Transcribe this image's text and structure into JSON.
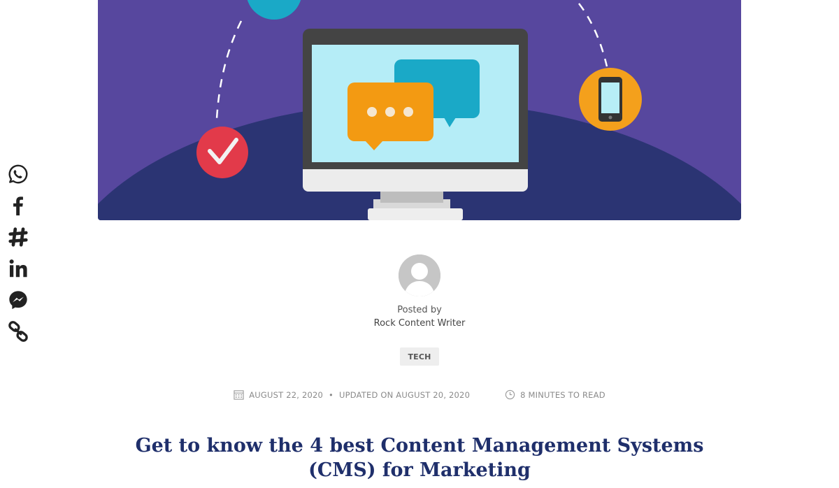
{
  "share": {
    "buttons": [
      {
        "name": "whatsapp-icon",
        "label": "WhatsApp"
      },
      {
        "name": "facebook-icon",
        "label": "Facebook"
      },
      {
        "name": "slack-icon",
        "label": "Slack"
      },
      {
        "name": "linkedin-icon",
        "label": "LinkedIn"
      },
      {
        "name": "messenger-icon",
        "label": "Messenger"
      },
      {
        "name": "link-icon",
        "label": "Copy link"
      }
    ],
    "icon_color": "#222222"
  },
  "hero": {
    "icons": [
      "monitor-icon",
      "chat-bubble-icon",
      "check-icon",
      "smartphone-icon"
    ],
    "colors": {
      "background": "#5a4aa0",
      "ground": "#2c3574",
      "accent_orange": "#f4a01c",
      "accent_teal": "#1aa9c7",
      "accent_red": "#e23a4a"
    }
  },
  "author": {
    "posted_by_label": "Posted by",
    "name": "Rock Content Writer"
  },
  "category": {
    "tag": "TECH"
  },
  "meta": {
    "published": "AUGUST 22, 2020",
    "separator": "•",
    "updated": "UPDATED ON AUGUST 20, 2020",
    "read_time": "8 MINUTES TO READ"
  },
  "article": {
    "title_line1": "Get to know the 4 best Content Management Systems",
    "title_line2": "(CMS) for Marketing",
    "title_color": "#1f2f6b"
  }
}
